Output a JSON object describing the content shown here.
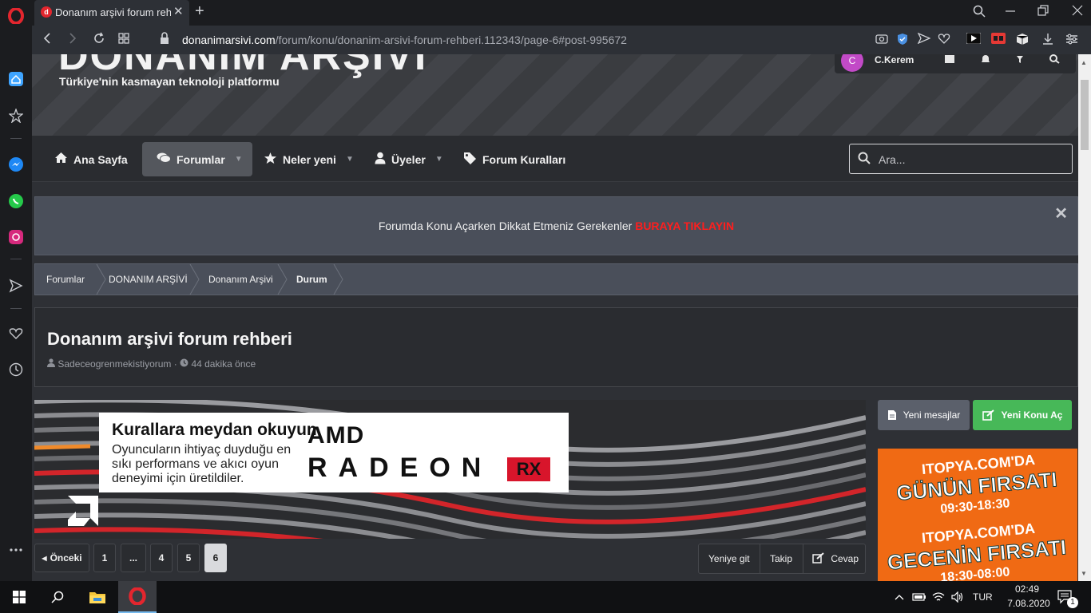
{
  "browser": {
    "tab_title": "Donanım arşivi forum rehbe",
    "url_host": "donanimarsivi.com",
    "url_path": "/forum/konu/donanim-arsivi-forum-rehberi.112343/page-6#post-995672"
  },
  "header": {
    "logo_text": "DONANIM ARŞİVİ",
    "tagline": "Türkiye'nin kasmayan teknoloji platformu",
    "user_name": "C.Kerem",
    "user_initial": "C"
  },
  "nav": {
    "items": [
      {
        "label": "Ana Sayfa",
        "icon": "home-icon"
      },
      {
        "label": "Forumlar",
        "icon": "comments-icon"
      },
      {
        "label": "Neler yeni",
        "icon": "star-icon"
      },
      {
        "label": "Üyeler",
        "icon": "user-icon"
      },
      {
        "label": "Forum Kuralları",
        "icon": "tag-icon"
      }
    ],
    "search_placeholder": "Ara..."
  },
  "notice": {
    "text": "Forumda Konu Açarken Dikkat Etmeniz Gerekenler",
    "link": "BURAYA TIKLAYIN"
  },
  "breadcrumb": [
    "Forumlar",
    "DONANIM ARŞİVİ",
    "Donanım Arşivi",
    "Durum"
  ],
  "thread": {
    "title": "Donanım arşivi forum rehberi",
    "author": "Sadeceogrenmekistiyorum",
    "time": "44 dakika önce"
  },
  "banner": {
    "headline": "Kurallara meydan okuyun",
    "subtext": "Oyuncuların ihtiyaç duyduğu en sıkı performans ve akıcı oyun deneyimi için üretildiler.",
    "brand": "AMD",
    "product": "RADEON",
    "badge": "RX"
  },
  "sidebar_buttons": {
    "new_messages": "Yeni mesajlar",
    "new_thread": "Yeni Konu Aç"
  },
  "side_ad": {
    "line1": "ITOPYA.COM'DA",
    "line2": "GÜNÜN FIRSATI",
    "line3": "09:30-18:30",
    "line4": "ITOPYA.COM'DA",
    "line5": "GECENİN FIRSATI",
    "line6": "18:30-08:00"
  },
  "pagination": {
    "prev": "Önceki",
    "pages": [
      "1",
      "...",
      "4",
      "5",
      "6"
    ],
    "current": "6"
  },
  "thread_actions": {
    "goto_new": "Yeniye git",
    "follow": "Takip",
    "reply": "Cevap"
  },
  "taskbar": {
    "language": "TUR",
    "time": "02:49",
    "date": "7.08.2020",
    "notification_count": "1"
  },
  "colors": {
    "accent_green": "#47b858",
    "notice_red": "#ff1e1e",
    "opera_red": "#e3262e",
    "ad_orange": "#f06a14"
  }
}
